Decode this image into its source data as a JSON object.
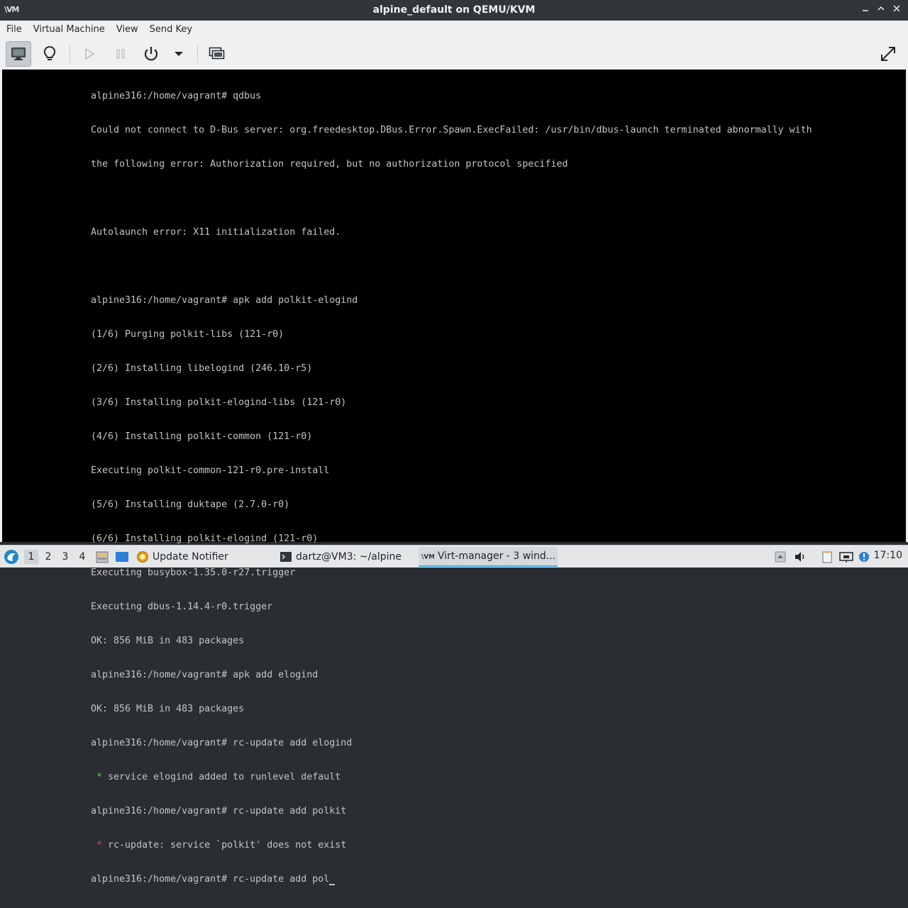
{
  "window": {
    "title": "alpine_default on QEMU/KVM",
    "app_icon_text": "\\VM",
    "buttons": [
      "minimize",
      "maximize",
      "close"
    ]
  },
  "menu": [
    "File",
    "Virtual Machine",
    "View",
    "Send Key"
  ],
  "toolbar": {
    "buttons": [
      "console-view",
      "details-view",
      "run",
      "pause",
      "power",
      "power-menu",
      "snapshots",
      "fullscreen"
    ]
  },
  "console": {
    "lines": [
      "alpine316:/home/vagrant# qdbus",
      "Could not connect to D-Bus server: org.freedesktop.DBus.Error.Spawn.ExecFailed: /usr/bin/dbus-launch terminated abnormally with",
      "the following error: Authorization required, but no authorization protocol specified",
      "",
      "Autolaunch error: X11 initialization failed.",
      "",
      "alpine316:/home/vagrant# apk add polkit-elogind",
      "(1/6) Purging polkit-libs (121-r0)",
      "(2/6) Installing libelogind (246.10-r5)",
      "(3/6) Installing polkit-elogind-libs (121-r0)",
      "(4/6) Installing polkit-common (121-r0)",
      "Executing polkit-common-121-r0.pre-install",
      "(5/6) Installing duktape (2.7.0-r0)",
      "(6/6) Installing polkit-elogind (121-r0)",
      "Executing busybox-1.35.0-r27.trigger",
      "Executing dbus-1.14.4-r0.trigger",
      "OK: 856 MiB in 483 packages",
      "alpine316:/home/vagrant# apk add elogind",
      "OK: 856 MiB in 483 packages",
      "alpine316:/home/vagrant# rc-update add elogind",
      "alpine316:/home/vagrant# rc-update add polkit",
      "alpine316:/home/vagrant# rc-update add pol"
    ],
    "green_msg": " service elogind added to runlevel default",
    "red_msg": " rc-update: service `polkit' does not exist",
    "star": "*"
  },
  "taskbar": {
    "desktops": [
      "1",
      "2",
      "3",
      "4"
    ],
    "tasks": {
      "update_notifier": "Update Notifier",
      "terminal": "dartz@VM3: ~/alpine",
      "virt_manager": "Virt-manager - 3 wind..."
    },
    "clock": "17:10"
  },
  "colors": {
    "titlebar_bg": "#31363b",
    "console_bg": "#000000",
    "console_text": "#c4c4c4",
    "ok_star": "#54d454",
    "error_star": "#e04040",
    "accent": "#3daee9"
  }
}
